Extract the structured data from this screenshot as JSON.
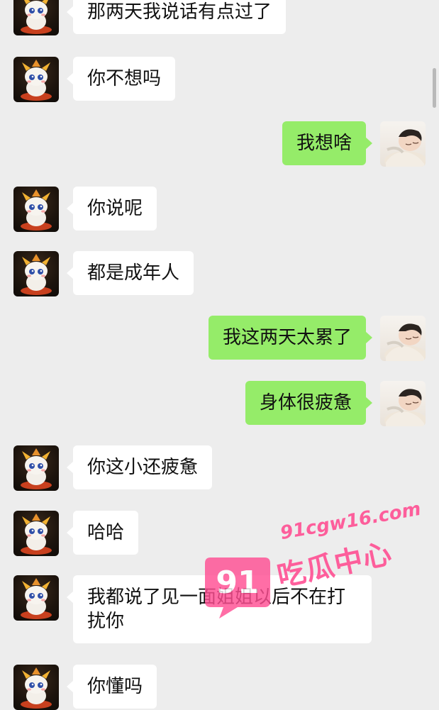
{
  "messages": [
    {
      "side": "left",
      "sender": "dragon",
      "text": "那两天我说话有点过了"
    },
    {
      "side": "left",
      "sender": "dragon",
      "text": "你不想吗"
    },
    {
      "side": "right",
      "sender": "boy",
      "text": "我想啥"
    },
    {
      "side": "left",
      "sender": "dragon",
      "text": "你说呢"
    },
    {
      "side": "left",
      "sender": "dragon",
      "text": "都是成年人"
    },
    {
      "side": "right",
      "sender": "boy",
      "text": "我这两天太累了"
    },
    {
      "side": "right",
      "sender": "boy",
      "text": "身体很疲惫"
    },
    {
      "side": "left",
      "sender": "dragon",
      "text": "你这小还疲惫"
    },
    {
      "side": "left",
      "sender": "dragon",
      "text": "哈哈"
    },
    {
      "side": "left",
      "sender": "dragon",
      "text": "我都说了见一面姐姐以后不在打扰你"
    },
    {
      "side": "left",
      "sender": "dragon",
      "text": "你懂吗"
    }
  ],
  "watermark": {
    "url": "91cgw16.com",
    "name": "吃瓜中心",
    "logo_text": "91"
  },
  "colors": {
    "background": "#ededed",
    "incoming_bubble": "#ffffff",
    "outgoing_bubble": "#95ec69",
    "watermark": "#ff4f93"
  }
}
